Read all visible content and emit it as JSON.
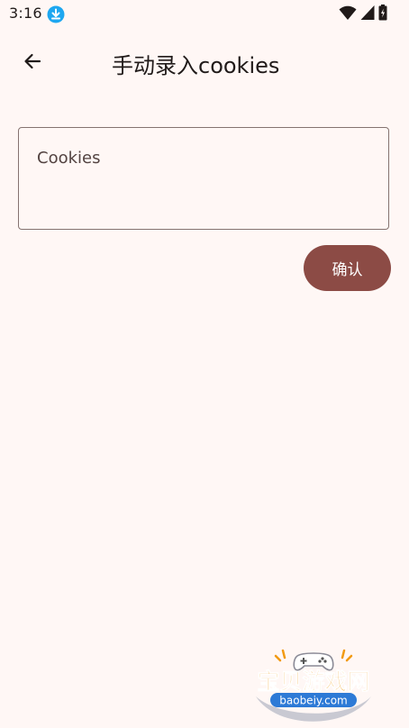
{
  "status_bar": {
    "time": "3:16",
    "icons": [
      "download-icon",
      "wifi-icon",
      "signal-icon",
      "battery-charging-icon"
    ]
  },
  "app_bar": {
    "back_icon": "arrow-left-icon",
    "title": "手动录入cookies"
  },
  "form": {
    "cookies_placeholder": "Cookies",
    "cookies_value": ""
  },
  "actions": {
    "confirm_label": "确认"
  },
  "watermark": {
    "title": "宝贝游戏网",
    "url": "baobeiy.com"
  },
  "colors": {
    "background": "#fff7f5",
    "primary_button": "#8c4b45",
    "outline": "#857370",
    "download_badge": "#1ea7f0",
    "watermark_orange": "#f29a12"
  }
}
